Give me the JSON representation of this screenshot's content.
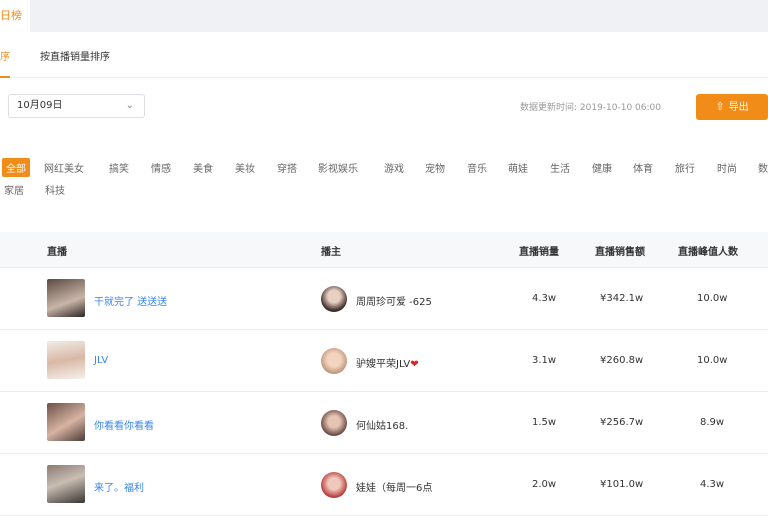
{
  "top_tab": {
    "label": "日榜"
  },
  "sub_tabs": [
    {
      "label": "序"
    },
    {
      "label": "按直播销量排序"
    }
  ],
  "date_select": {
    "value": "10月09日"
  },
  "updated": {
    "label": "数据更新时间: 2019-10-10 06:00"
  },
  "export": {
    "label": "导出"
  },
  "categories": [
    "全部",
    "网红美女",
    "搞笑",
    "情感",
    "美食",
    "美妆",
    "穿搭",
    "影视娱乐",
    "游戏",
    "宠物",
    "音乐",
    "萌娃",
    "生活",
    "健康",
    "体育",
    "旅行",
    "时尚",
    "数码",
    "家居",
    "科技"
  ],
  "table": {
    "headers": [
      "直播",
      "播主",
      "直播销量",
      "直播销售额",
      "直播峰值人数"
    ],
    "rows": [
      {
        "title": "干就完了 送送送",
        "anchor": "周周珍可爱 -625",
        "sales": "4.3w",
        "revenue": "¥342.1w",
        "peak": "10.0w"
      },
      {
        "title": "JLV",
        "anchor": "驴嫂平荣JLV",
        "sales": "3.1w",
        "revenue": "¥260.8w",
        "peak": "10.0w"
      },
      {
        "title": "你看看你看看",
        "anchor": "何仙姑168.",
        "sales": "1.5w",
        "revenue": "¥256.7w",
        "peak": "8.9w"
      },
      {
        "title": "来了。福利",
        "anchor": "娃娃（每周一6点",
        "sales": "2.0w",
        "revenue": "¥101.0w",
        "peak": "4.3w"
      }
    ]
  },
  "colors": {
    "accent": "#f28c18",
    "link": "#3b86e8"
  }
}
